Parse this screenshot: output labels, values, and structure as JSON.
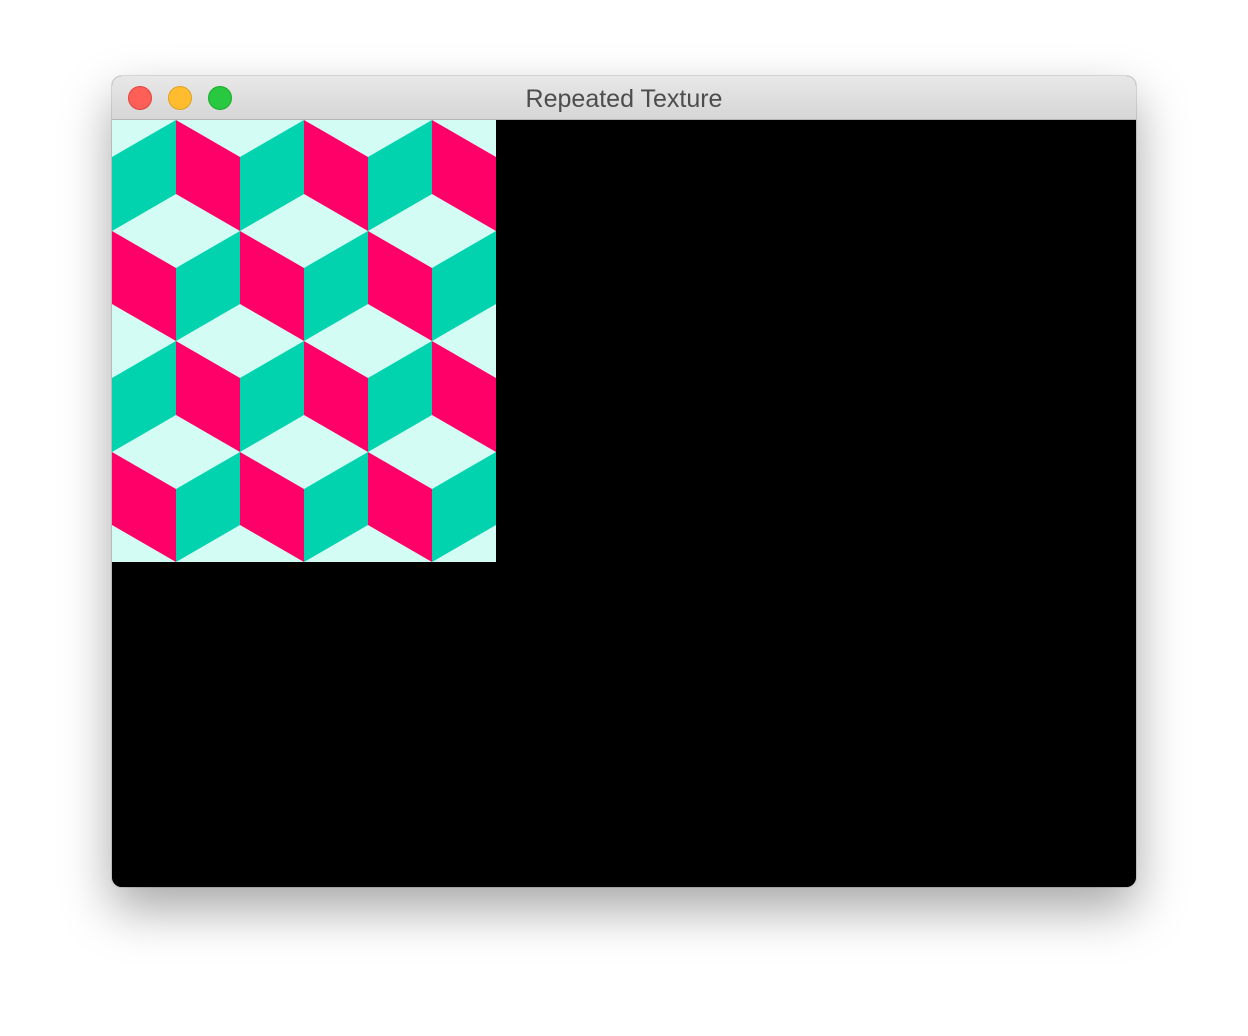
{
  "window": {
    "title": "Repeated Texture",
    "controls": [
      "close",
      "minimize",
      "zoom"
    ]
  },
  "canvas": {
    "background_color": "#000000",
    "texture": {
      "pattern": "isometric-cubes",
      "colors": {
        "top": "#d3fcf4",
        "left": "#00d3ad",
        "right": "#fe0067"
      }
    }
  }
}
